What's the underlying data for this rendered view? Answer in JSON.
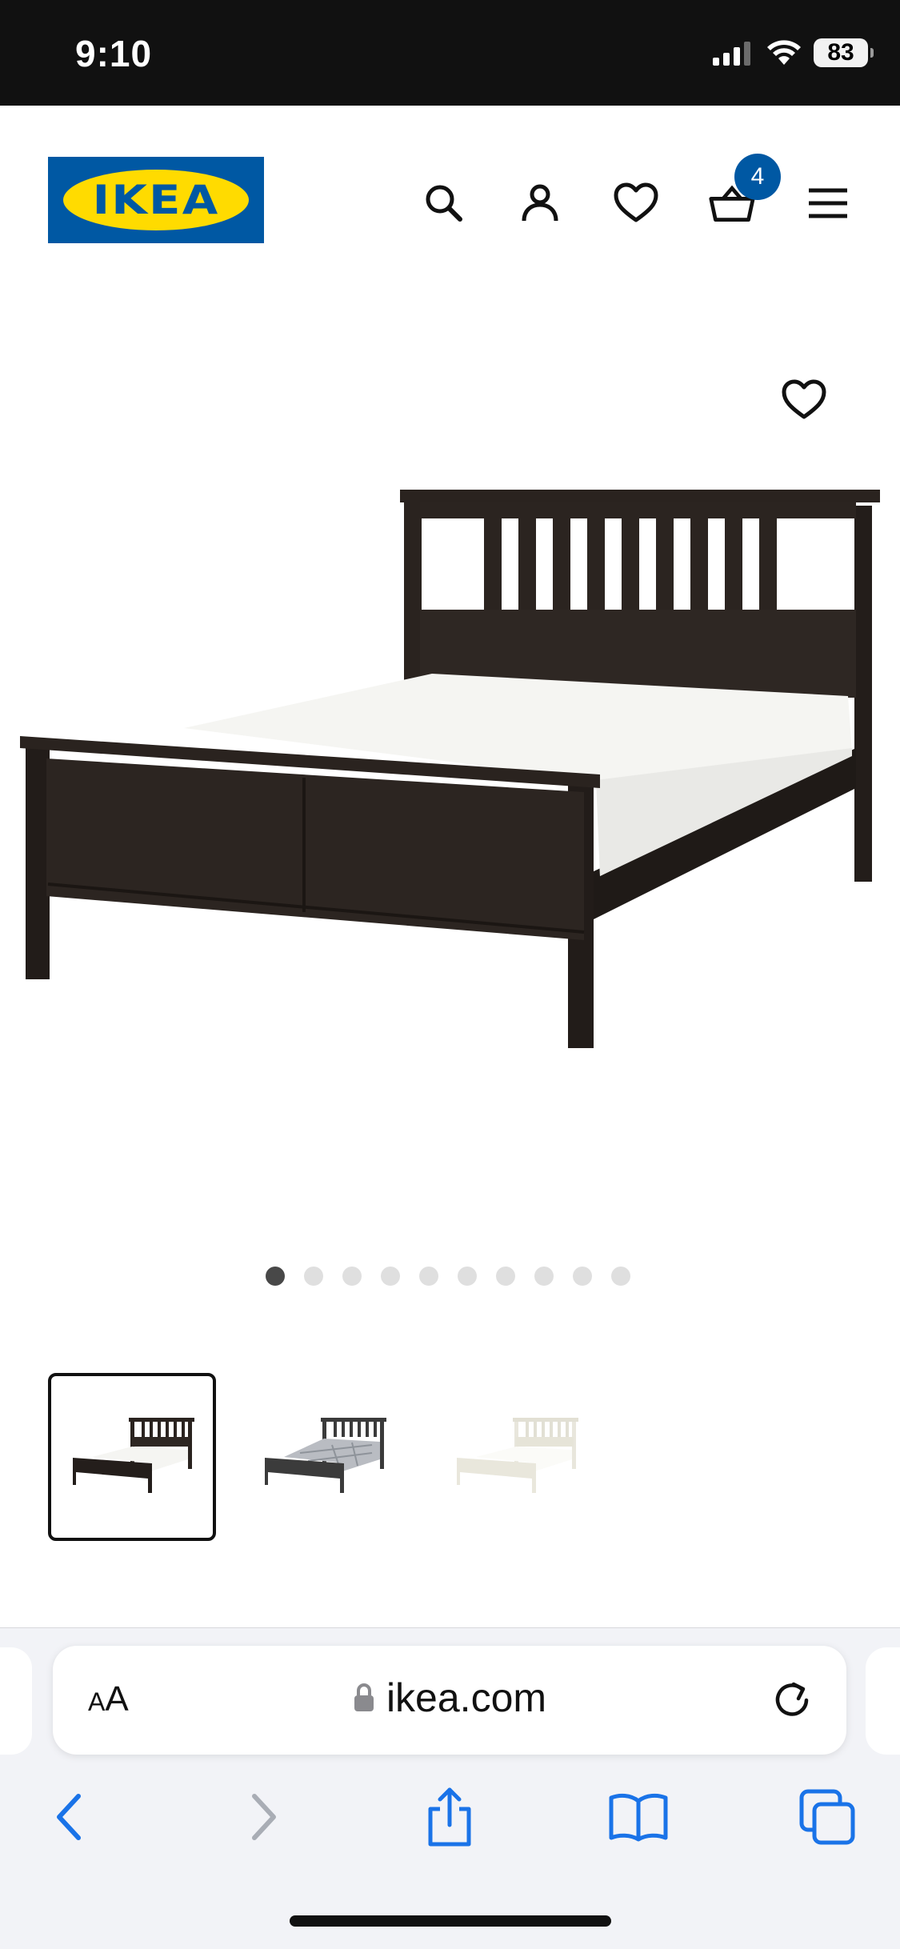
{
  "status_bar": {
    "time": "9:10",
    "battery": "83"
  },
  "header": {
    "logo_text": "IKEA",
    "cart_count": "4",
    "icons": [
      "search-icon",
      "account-icon",
      "heart-icon",
      "cart-icon",
      "menu-icon"
    ]
  },
  "product": {
    "image_count": 10,
    "active_image": 1,
    "thumbnails": [
      "dark-bed-thumbnail",
      "dark-bed-with-bedding-thumbnail",
      "white-bed-thumbnail"
    ],
    "selected_thumbnail": 1
  },
  "browser": {
    "text_size_label_small": "A",
    "text_size_label_large": "A",
    "url": "ikea.com"
  },
  "colors": {
    "brand_blue": "#0058a3",
    "brand_yellow": "#ffdb00",
    "safari_blue": "#1a73e8"
  }
}
